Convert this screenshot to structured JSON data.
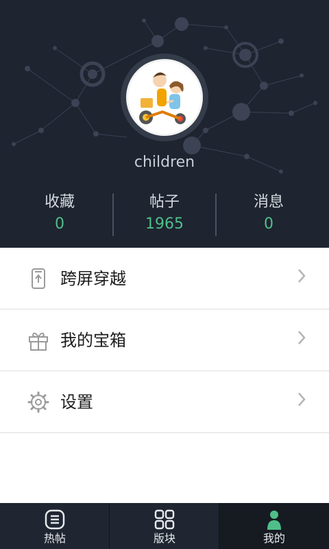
{
  "profile": {
    "username": "children",
    "avatar": "avatar-kids-on-tricycle"
  },
  "stats": [
    {
      "label": "收藏",
      "value": "0"
    },
    {
      "label": "帖子",
      "value": "1965"
    },
    {
      "label": "消息",
      "value": "0"
    }
  ],
  "menu": [
    {
      "label": "跨屏穿越",
      "icon": "phone-upload-icon"
    },
    {
      "label": "我的宝箱",
      "icon": "gift-icon"
    },
    {
      "label": "设置",
      "icon": "gear-icon"
    }
  ],
  "tabbar": [
    {
      "label": "热帖",
      "icon": "list-icon",
      "active": false
    },
    {
      "label": "版块",
      "icon": "grid-icon",
      "active": false
    },
    {
      "label": "我的",
      "icon": "person-icon",
      "active": true
    }
  ],
  "colors": {
    "header_bg": "#1e2430",
    "accent": "#4fbf89",
    "tabbar_bg": "#1f2631"
  }
}
